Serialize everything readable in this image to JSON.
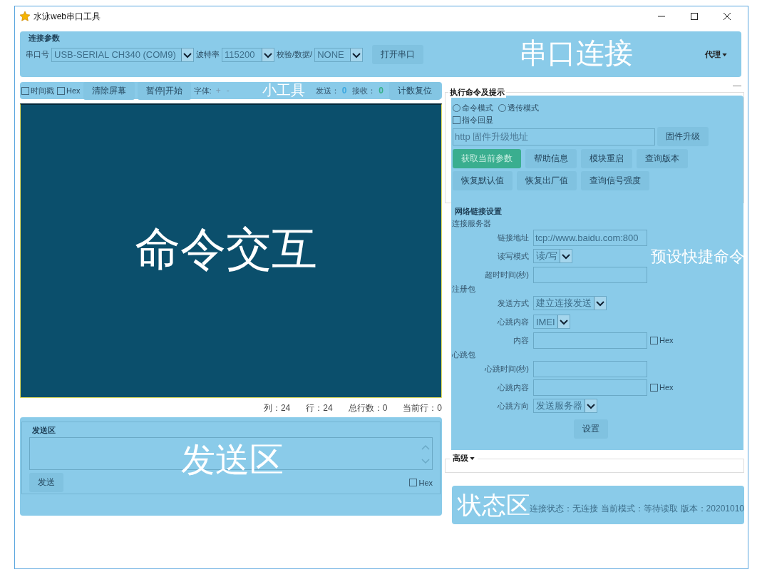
{
  "window": {
    "title": "水泳web串口工具"
  },
  "connection": {
    "legend": "连接参数",
    "overlay_label": "串口连接",
    "port_label": "串口号",
    "port_value": "USB-SERIAL CH340 (COM9)",
    "baud_label": "波特率",
    "baud_value": "115200",
    "parity_label": "校验/数据/",
    "parity_value": "NONE",
    "open_button": "打开串口",
    "proxy_menu": "代理"
  },
  "toolbar": {
    "overlay_label": "小工具",
    "checkboxes": [
      {
        "label": "时间戳",
        "checked": false
      },
      {
        "label": "Hex",
        "checked": false
      }
    ],
    "buttons": [
      "清除屏幕",
      "暂停|开始"
    ],
    "font_label": "字体:",
    "font_buttons": [
      "+",
      "-"
    ],
    "counters": [
      {
        "label": "发送：",
        "value": "0",
        "color": "#3ba8e0"
      },
      {
        "label": "接收：",
        "value": "0",
        "color": "#35b08a"
      }
    ],
    "reset_button": "计数复位"
  },
  "terminal": {
    "overlay_label": "命令交互",
    "position": [
      {
        "label": "列：",
        "value": "24"
      },
      {
        "label": "行：",
        "value": "24"
      },
      {
        "label": "总行数：",
        "value": "0"
      },
      {
        "label": "当前行：",
        "value": "0"
      }
    ]
  },
  "send_area": {
    "legend": "发送区",
    "overlay_label": "发送区",
    "send_button": "发送",
    "hex": {
      "label": "Hex",
      "checked": false
    }
  },
  "commands": {
    "collapse": "—",
    "legend": "执行命令及提示",
    "modes": [
      {
        "label": "命令模式",
        "selected": false
      },
      {
        "label": "透传模式",
        "selected": false
      }
    ],
    "echo": {
      "label": "指令回显",
      "checked": false
    },
    "firmware": {
      "placeholder": "http 固件升级地址",
      "button": "固件升级"
    },
    "buttons": [
      [
        {
          "label": "获取当前参数",
          "primary": true
        },
        {
          "label": "帮助信息",
          "primary": false
        },
        {
          "label": "模块重启",
          "primary": false
        },
        {
          "label": "查询版本",
          "primary": false
        }
      ],
      [
        {
          "label": "恢复默认值",
          "primary": false
        },
        {
          "label": "恢复出厂值",
          "primary": false
        },
        {
          "label": "查询信号强度",
          "primary": false
        }
      ]
    ]
  },
  "network": {
    "legend": "网络链接设置",
    "overlay_label": "预设快捷命令",
    "groups": [
      {
        "title": "连接服务器",
        "rows": [
          {
            "label": "链接地址",
            "kind": "input",
            "value": "tcp://www.baidu.com:800"
          },
          {
            "label": "读写模式",
            "kind": "select",
            "value": "读/写"
          },
          {
            "label": "超时时间(秒)",
            "kind": "input"
          }
        ]
      },
      {
        "title": "注册包",
        "rows": [
          {
            "label": "发送方式",
            "kind": "select",
            "value": "建立连接发送"
          },
          {
            "label": "心跳内容",
            "kind": "select",
            "value": "IMEI"
          },
          {
            "label": "内容",
            "kind": "input",
            "hex": {
              "label": "Hex",
              "checked": false
            }
          }
        ]
      },
      {
        "title": "心跳包",
        "rows": [
          {
            "label": "心跳时间(秒)",
            "kind": "input"
          },
          {
            "label": "心跳内容",
            "kind": "input",
            "hex": {
              "label": "Hex",
              "checked": false
            }
          },
          {
            "label": "心跳方向",
            "kind": "select",
            "value": "发送服务器"
          }
        ]
      }
    ],
    "button": "设置"
  },
  "advanced": {
    "label": "高级"
  },
  "status": {
    "overlay_label": "状态区",
    "items": [
      {
        "label": "连接状态：",
        "value": "无连接"
      },
      {
        "label": "当前模式：",
        "value": "等待读取"
      },
      {
        "label": "版本：",
        "value": "20201010"
      }
    ]
  }
}
